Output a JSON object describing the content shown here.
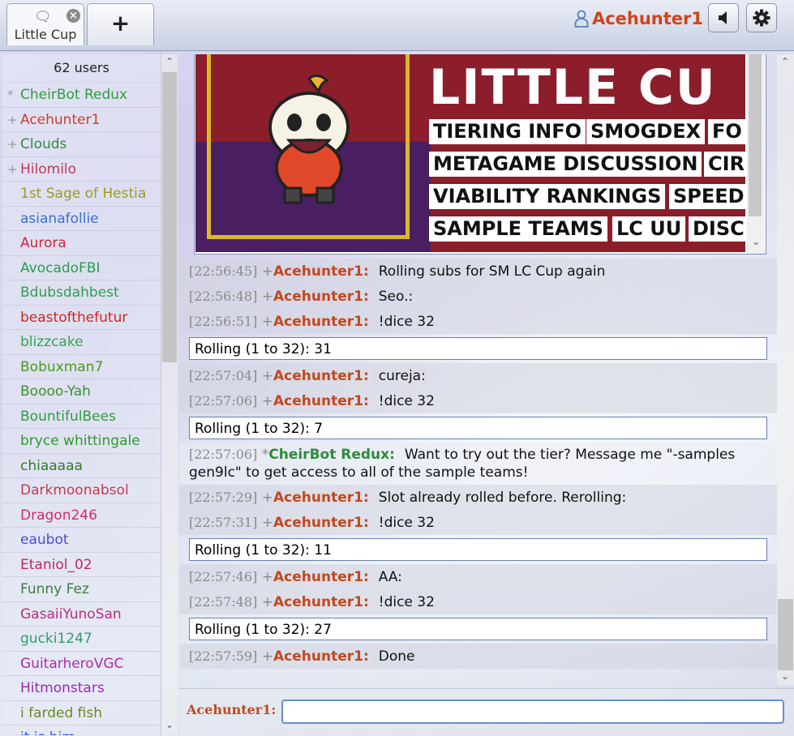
{
  "tabs": {
    "room_label": "Little Cup",
    "room_icon": "chat-bubble-icon",
    "close_icon": "close-icon",
    "new_tab_label": "+"
  },
  "header": {
    "username": "Acehunter1",
    "sound_icon": "speaker-icon",
    "settings_icon": "gear-icon"
  },
  "userlist": {
    "count": "62 users",
    "users": [
      {
        "group": "*",
        "name": "CheirBot Redux",
        "color": "#2e9e3c"
      },
      {
        "group": "+",
        "name": "Acehunter1",
        "color": "#c8402a"
      },
      {
        "group": "+",
        "name": "Clouds",
        "color": "#2f8a3e"
      },
      {
        "group": "+",
        "name": "Hilomilo",
        "color": "#c23a55"
      },
      {
        "group": "",
        "name": "1st Sage of Hestia",
        "color": "#9a9a22"
      },
      {
        "group": "",
        "name": "asianafollie",
        "color": "#3a6fd6"
      },
      {
        "group": "",
        "name": "Aurora",
        "color": "#d6253a"
      },
      {
        "group": "",
        "name": "AvocadoFBI",
        "color": "#25a047"
      },
      {
        "group": "",
        "name": "Bdubsdahbest",
        "color": "#2e9e4e"
      },
      {
        "group": "",
        "name": "beastofthefutur",
        "color": "#c92a1e"
      },
      {
        "group": "",
        "name": "blizzcake",
        "color": "#2ea84a"
      },
      {
        "group": "",
        "name": "Bobuxman7",
        "color": "#4a9a1e"
      },
      {
        "group": "",
        "name": "Boooo-Yah",
        "color": "#3f8f2e"
      },
      {
        "group": "",
        "name": "BountifulBees",
        "color": "#2e9e3c"
      },
      {
        "group": "",
        "name": "bryce whittingale",
        "color": "#2e9a2e"
      },
      {
        "group": "",
        "name": "chiaaaaa",
        "color": "#2e7e22"
      },
      {
        "group": "",
        "name": "Darkmoonabsol",
        "color": "#c43a4a"
      },
      {
        "group": "",
        "name": "Dragon246",
        "color": "#d12a6a"
      },
      {
        "group": "",
        "name": "eaubot",
        "color": "#4a4ad6"
      },
      {
        "group": "",
        "name": "Etaniol_02",
        "color": "#b82a6a"
      },
      {
        "group": "",
        "name": "Funny Fez",
        "color": "#3e7e3e"
      },
      {
        "group": "",
        "name": "GasaiiYunoSan",
        "color": "#c22a7a"
      },
      {
        "group": "",
        "name": "gucki1247",
        "color": "#2e9e6e"
      },
      {
        "group": "",
        "name": "GuitarheroVGC",
        "color": "#b22aaa"
      },
      {
        "group": "",
        "name": "Hitmonstars",
        "color": "#9a2ab2"
      },
      {
        "group": "",
        "name": "i farded fish",
        "color": "#6a8a1e"
      },
      {
        "group": "",
        "name": "it is him",
        "color": "#3a5ad6"
      }
    ]
  },
  "banner": {
    "title": "LITTLE CU",
    "pills": [
      "TIERING INFO",
      "SMOGDEX",
      "FO",
      "METAGAME DISCUSSION",
      "CIR",
      "VIABILITY RANKINGS",
      "SPEED",
      "SAMPLE TEAMS",
      "LC UU",
      "DISC"
    ]
  },
  "messages": [
    {
      "type": "chat",
      "ts": "[22:56:45]",
      "prefix": "+",
      "name": "Acehunter1:",
      "text": "Rolling subs for SM LC Cup again",
      "shade": "dark"
    },
    {
      "type": "chat",
      "ts": "[22:56:48]",
      "prefix": "+",
      "name": "Acehunter1:",
      "text": "Seo.:",
      "shade": "dark"
    },
    {
      "type": "chat",
      "ts": "[22:56:51]",
      "prefix": "+",
      "name": "Acehunter1:",
      "text": "!dice 32",
      "shade": "dark"
    },
    {
      "type": "roll",
      "text": "Rolling (1 to 32): 31"
    },
    {
      "type": "chat",
      "ts": "[22:57:04]",
      "prefix": "+",
      "name": "Acehunter1:",
      "text": "cureja:",
      "shade": "dark"
    },
    {
      "type": "chat",
      "ts": "[22:57:06]",
      "prefix": "+",
      "name": "Acehunter1:",
      "text": "!dice 32",
      "shade": "dark"
    },
    {
      "type": "roll",
      "text": "Rolling (1 to 32): 7"
    },
    {
      "type": "chat",
      "ts": "[22:57:06]",
      "prefix": "*",
      "name": "CheirBot Redux:",
      "text": "Want to try out the tier? Message me \"-samples gen9lc\" to get access to all of the sample teams!",
      "shade": "light",
      "bot": true
    },
    {
      "type": "chat",
      "ts": "[22:57:29]",
      "prefix": "+",
      "name": "Acehunter1:",
      "text": "Slot already rolled before. Rerolling:",
      "shade": "dark"
    },
    {
      "type": "chat",
      "ts": "[22:57:31]",
      "prefix": "+",
      "name": "Acehunter1:",
      "text": "!dice 32",
      "shade": "dark"
    },
    {
      "type": "roll",
      "text": "Rolling (1 to 32): 11"
    },
    {
      "type": "chat",
      "ts": "[22:57:46]",
      "prefix": "+",
      "name": "Acehunter1:",
      "text": "AA:",
      "shade": "dark"
    },
    {
      "type": "chat",
      "ts": "[22:57:48]",
      "prefix": "+",
      "name": "Acehunter1:",
      "text": "!dice 32",
      "shade": "dark"
    },
    {
      "type": "roll",
      "text": "Rolling (1 to 32): 27"
    },
    {
      "type": "chat",
      "ts": "[22:57:59]",
      "prefix": "+",
      "name": "Acehunter1:",
      "text": "Done",
      "shade": "dark"
    }
  ],
  "composer": {
    "label": "Acehunter1:",
    "value": "",
    "placeholder": ""
  }
}
